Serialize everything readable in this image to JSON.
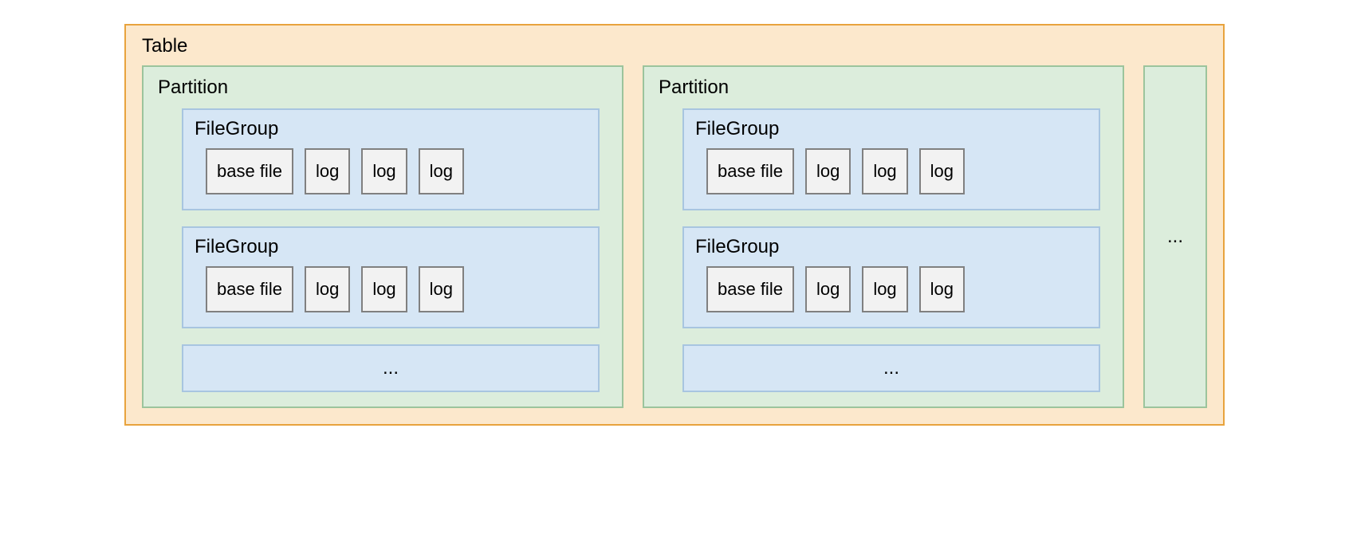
{
  "table": {
    "label": "Table"
  },
  "partitions": [
    {
      "label": "Partition",
      "filegroups": [
        {
          "label": "FileGroup",
          "files": [
            "base file",
            "log",
            "log",
            "log"
          ]
        },
        {
          "label": "FileGroup",
          "files": [
            "base file",
            "log",
            "log",
            "log"
          ]
        }
      ],
      "more": "..."
    },
    {
      "label": "Partition",
      "filegroups": [
        {
          "label": "FileGroup",
          "files": [
            "base file",
            "log",
            "log",
            "log"
          ]
        },
        {
          "label": "FileGroup",
          "files": [
            "base file",
            "log",
            "log",
            "log"
          ]
        }
      ],
      "more": "..."
    }
  ],
  "partitions_more": "..."
}
